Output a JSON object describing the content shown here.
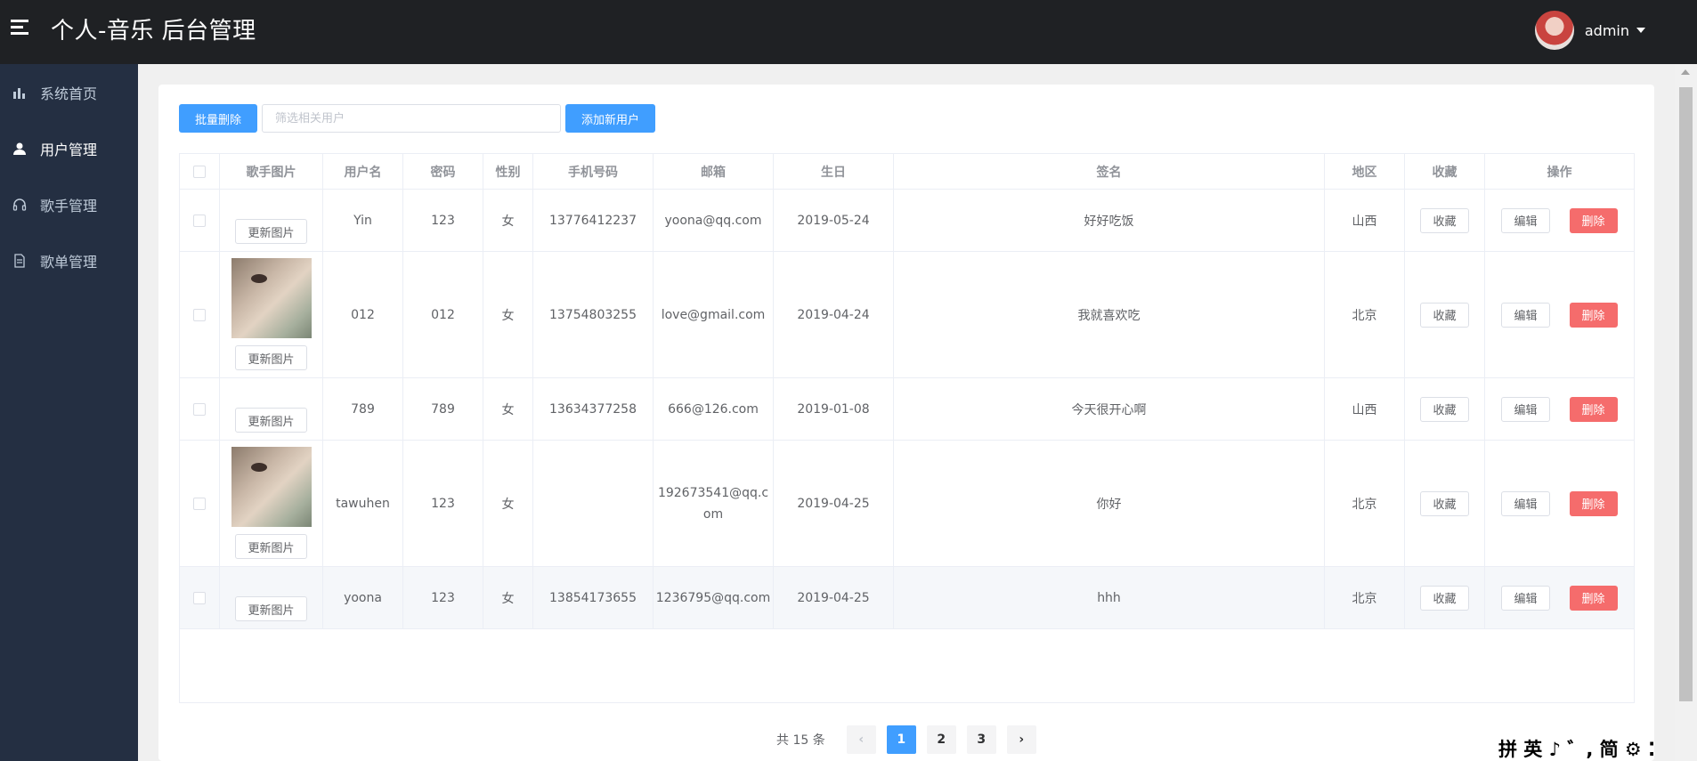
{
  "header": {
    "title": "个人-音乐 后台管理",
    "username": "admin"
  },
  "sidebar": {
    "items": [
      {
        "label": "系统首页"
      },
      {
        "label": "用户管理"
      },
      {
        "label": "歌手管理"
      },
      {
        "label": "歌单管理"
      }
    ]
  },
  "toolbar": {
    "batch_delete": "批量删除",
    "search_placeholder": "筛选相关用户",
    "add_user": "添加新用户"
  },
  "table": {
    "headers": [
      "歌手图片",
      "用户名",
      "密码",
      "性别",
      "手机号码",
      "邮箱",
      "生日",
      "签名",
      "地区",
      "收藏",
      "操作"
    ],
    "update_image_label": "更新图片",
    "favorite_label": "收藏",
    "edit_label": "编辑",
    "delete_label": "删除",
    "rows": [
      {
        "username": "Yin",
        "password": "123",
        "gender": "女",
        "phone": "13776412237",
        "email": "yoona@qq.com",
        "birthday": "2019-05-24",
        "signature": "好好吃饭",
        "region": "山西"
      },
      {
        "username": "012",
        "password": "012",
        "gender": "女",
        "phone": "13754803255",
        "email": "love@gmail.com",
        "birthday": "2019-04-24",
        "signature": "我就喜欢吃",
        "region": "北京"
      },
      {
        "username": "789",
        "password": "789",
        "gender": "女",
        "phone": "13634377258",
        "email": "666@126.com",
        "birthday": "2019-01-08",
        "signature": "今天很开心啊",
        "region": "山西"
      },
      {
        "username": "tawuhen",
        "password": "123",
        "gender": "女",
        "phone": "",
        "email": "192673541@qq.c\nom",
        "birthday": "2019-04-25",
        "signature": "你好",
        "region": "北京"
      },
      {
        "username": "yoona",
        "password": "123",
        "gender": "女",
        "phone": "13854173655",
        "email": "1236795@qq.com",
        "birthday": "2019-04-25",
        "signature": "hhh",
        "region": "北京"
      }
    ]
  },
  "pagination": {
    "total_text": "共 15 条",
    "pages": [
      "1",
      "2",
      "3"
    ],
    "current": "1"
  },
  "ime": {
    "text": "拼 英 ♪ ゛, 简 ⚙ ⁚"
  }
}
